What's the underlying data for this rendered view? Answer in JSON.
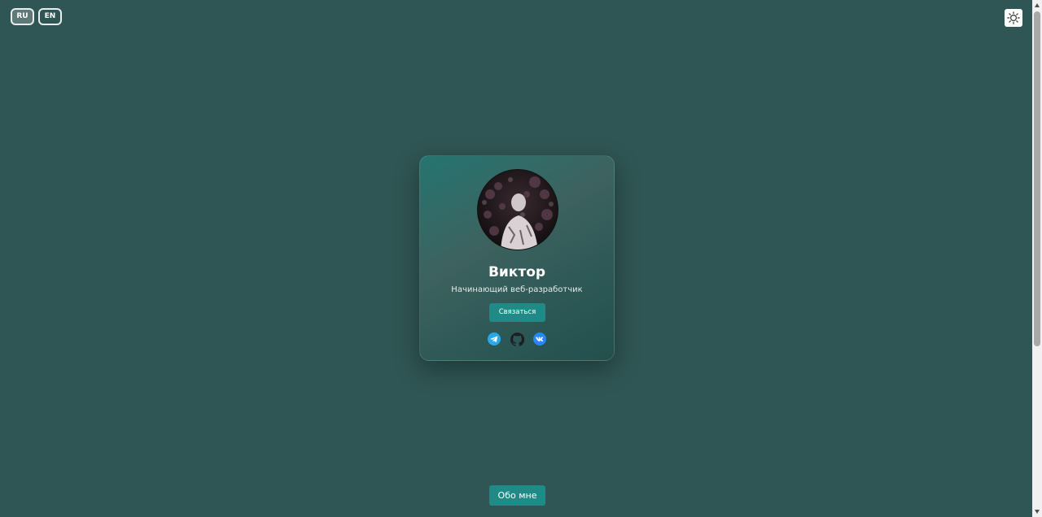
{
  "lang": {
    "ru": "RU",
    "en": "EN",
    "active": "RU"
  },
  "theme": {
    "icon": "sun-icon"
  },
  "card": {
    "name": "Виктор",
    "role": "Начинающий веб-разработчик",
    "contact_label": "Связаться",
    "socials": [
      {
        "icon": "telegram-icon",
        "color": "#29a9ea"
      },
      {
        "icon": "github-icon",
        "color": "#1b1f23"
      },
      {
        "icon": "vk-icon",
        "color": "#2787f5"
      }
    ]
  },
  "about_label": "Обо мне",
  "colors": {
    "background": "#2f5654",
    "accent": "#1f8a86"
  }
}
